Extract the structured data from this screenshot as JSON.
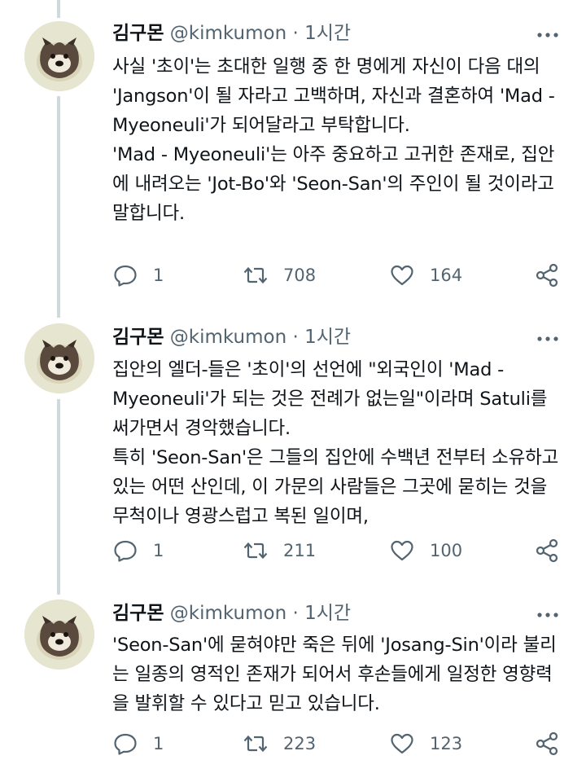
{
  "tweets": [
    {
      "name": "김구몬",
      "handle": "@kimkumon",
      "separator": "·",
      "time": "1시간",
      "body": "사실 '초이'는 초대한 일행 중 한 명에게 자신이 다음 대의 'Jangson'이 될 자라고 고백하며, 자신과 결혼하여 'Mad -\nMyeoneuli'가 되어달라고 부탁합니다.\n'Mad - Myeoneuli'는 아주 중요하고 고귀한 존재로, 집안에 내려오는 'Jot-Bo'와 'Seon-San'의 주인이 될 것이라고 말합니다.",
      "replies": "1",
      "retweets": "708",
      "likes": "164"
    },
    {
      "name": "김구몬",
      "handle": "@kimkumon",
      "separator": "·",
      "time": "1시간",
      "body": "집안의 엘더-들은 '초이'의 선언에 \"외국인이 'Mad - Myeoneuli'가 되는 것은 전례가 없는일\"이라며 Satuli를 써가면서 경악했습니다.\n특히 'Seon-San'은 그들의 집안에 수백년 전부터 소유하고 있는 어떤 산인데, 이 가문의 사람들은 그곳에 묻히는 것을 무척이나 영광스럽고 복된 일이며,",
      "replies": "1",
      "retweets": "211",
      "likes": "100"
    },
    {
      "name": "김구몬",
      "handle": "@kimkumon",
      "separator": "·",
      "time": "1시간",
      "body": "'Seon-San'에 묻혀야만 죽은 뒤에 'Josang-Sin'이라 불리는 일종의 영적인 존재가 되어서 후손들에게 일정한 영향력을 발휘할 수 있다고 믿고 있습니다.",
      "replies": "1",
      "retweets": "223",
      "likes": "123"
    }
  ],
  "icons": {
    "reply": "speech-bubble-icon",
    "retweet": "retweet-arrows-icon",
    "like": "heart-icon",
    "share": "share-icon",
    "more": "more-dots-icon"
  },
  "colors": {
    "text": "#0f1419",
    "secondary": "#536471",
    "thread_line": "#cfd9de"
  }
}
